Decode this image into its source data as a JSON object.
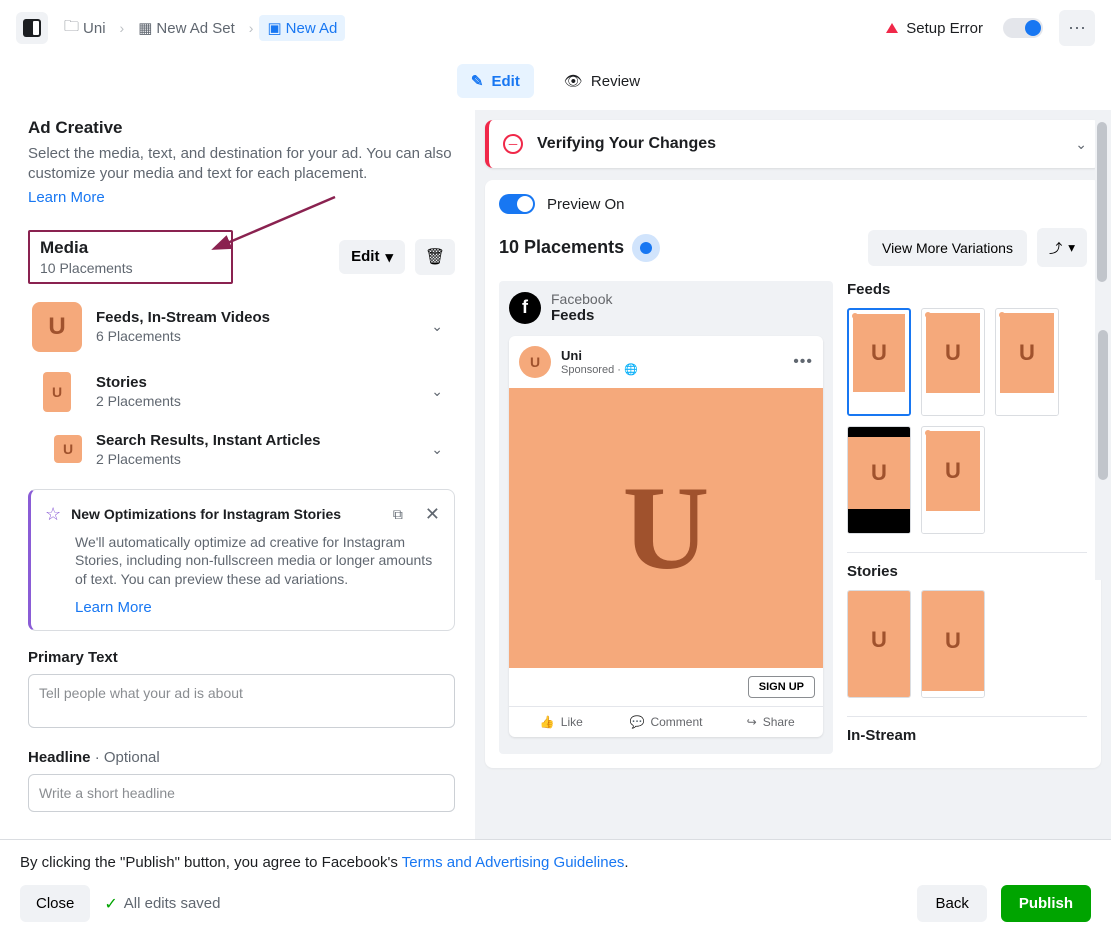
{
  "breadcrumb": {
    "campaign": "Uni",
    "adset": "New Ad Set",
    "ad": "New Ad"
  },
  "header": {
    "setup_error": "Setup Error"
  },
  "tabs": {
    "edit": "Edit",
    "review": "Review"
  },
  "creative": {
    "title": "Ad Creative",
    "desc": "Select the media, text, and destination for your ad. You can also customize your media and text for each placement.",
    "learn_more": "Learn More"
  },
  "media": {
    "title": "Media",
    "subtitle": "10 Placements",
    "edit": "Edit",
    "groups": [
      {
        "name": "Feeds, In-Stream Videos",
        "sub": "6 Placements"
      },
      {
        "name": "Stories",
        "sub": "2 Placements"
      },
      {
        "name": "Search Results, Instant Articles",
        "sub": "2 Placements"
      }
    ]
  },
  "info": {
    "title": "New Optimizations for Instagram Stories",
    "body": "We'll automatically optimize ad creative for Instagram Stories, including non-fullscreen media or longer amounts of text. You can preview these ad variations.",
    "learn_more": "Learn More"
  },
  "fields": {
    "primary_label": "Primary Text",
    "primary_ph": "Tell people what your ad is about",
    "headline_label": "Headline",
    "headline_opt": " · Optional",
    "headline_ph": "Write a short headline"
  },
  "verify": {
    "title": "Verifying Your Changes"
  },
  "preview": {
    "on_label": "Preview On",
    "count": "10 Placements",
    "view_more": "View More Variations",
    "network": "Facebook",
    "network_sub": "Feeds",
    "brand": "Uni",
    "sponsored": "Sponsored · 🌐",
    "signup": "SIGN UP",
    "like": "Like",
    "comment": "Comment",
    "share": "Share",
    "sec_feeds": "Feeds",
    "sec_stories": "Stories",
    "sec_instream": "In-Stream"
  },
  "footer": {
    "agree_pre": "By clicking the \"Publish\" button, you agree to Facebook's ",
    "agree_link": "Terms and Advertising Guidelines",
    "agree_post": ".",
    "close": "Close",
    "saved": "All edits saved",
    "back": "Back",
    "publish": "Publish"
  }
}
